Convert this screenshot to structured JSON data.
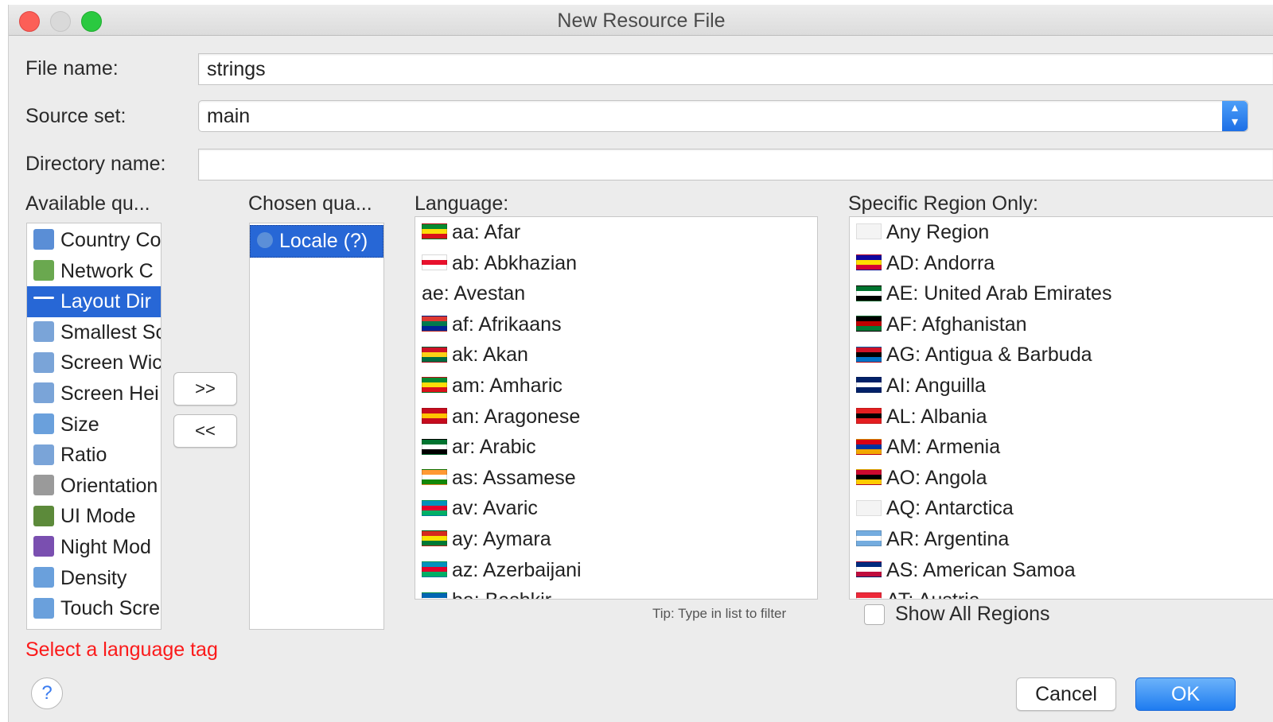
{
  "window": {
    "title": "New Resource File"
  },
  "form": {
    "file_name_label": "File name:",
    "file_name_value": "strings",
    "source_set_label": "Source set:",
    "source_set_value": "main",
    "directory_name_label": "Directory name:",
    "directory_name_value": ""
  },
  "available": {
    "header": "Available qu...",
    "items": [
      {
        "label": "Country Co",
        "icon": "globe-phone-icon",
        "color": "#5a8ed6"
      },
      {
        "label": "Network C",
        "icon": "network-icon",
        "color": "#6aa84f"
      },
      {
        "label": "Layout Dir",
        "icon": "layout-direction-icon",
        "color": "#ffffff"
      },
      {
        "label": "Smallest Sc",
        "icon": "smallest-screen-icon",
        "color": "#7aa4d8"
      },
      {
        "label": "Screen Wic",
        "icon": "screen-width-icon",
        "color": "#7aa4d8"
      },
      {
        "label": "Screen Hei",
        "icon": "screen-height-icon",
        "color": "#7aa4d8"
      },
      {
        "label": "Size",
        "icon": "size-icon",
        "color": "#6aa0dc"
      },
      {
        "label": "Ratio",
        "icon": "ratio-icon",
        "color": "#7aa4d8"
      },
      {
        "label": "Orientation",
        "icon": "orientation-icon",
        "color": "#9a9a9a"
      },
      {
        "label": "UI Mode",
        "icon": "ui-mode-icon",
        "color": "#5c8a3a"
      },
      {
        "label": "Night Mod",
        "icon": "night-mode-icon",
        "color": "#7a4fb0"
      },
      {
        "label": "Density",
        "icon": "density-icon",
        "color": "#6aa0dc"
      },
      {
        "label": "Touch Scre",
        "icon": "touch-screen-icon",
        "color": "#6aa0dc"
      }
    ],
    "selected_index": 2
  },
  "transfer": {
    "add_label": ">>",
    "remove_label": "<<"
  },
  "chosen": {
    "header": "Chosen qua...",
    "items": [
      {
        "label": "Locale (?)",
        "icon": "globe-icon"
      }
    ]
  },
  "language": {
    "header": "Language:",
    "items": [
      {
        "label": "aa: Afar",
        "flag": [
          "#078930",
          "#fcdd09",
          "#da121a"
        ]
      },
      {
        "label": "ab: Abkhazian",
        "flag": [
          "#ffffff",
          "#e8112d",
          "#ffffff"
        ]
      },
      {
        "label": "ae: Avestan",
        "flag": []
      },
      {
        "label": "af: Afrikaans",
        "flag": [
          "#de3831",
          "#007a4d",
          "#002395"
        ]
      },
      {
        "label": "ak: Akan",
        "flag": [
          "#ce1126",
          "#fcd116",
          "#006b3f"
        ]
      },
      {
        "label": "am: Amharic",
        "flag": [
          "#078930",
          "#fcdd09",
          "#da121a"
        ]
      },
      {
        "label": "an: Aragonese",
        "flag": [
          "#c60b1e",
          "#ffc400",
          "#c60b1e"
        ]
      },
      {
        "label": "ar: Arabic",
        "flag": [
          "#00732f",
          "#ffffff",
          "#000000"
        ]
      },
      {
        "label": "as: Assamese",
        "flag": [
          "#ff9933",
          "#ffffff",
          "#138808"
        ]
      },
      {
        "label": "av: Avaric",
        "flag": [
          "#0092bc",
          "#e4002b",
          "#00af66"
        ]
      },
      {
        "label": "ay: Aymara",
        "flag": [
          "#d52b1e",
          "#f9e300",
          "#007934"
        ]
      },
      {
        "label": "az: Azerbaijani",
        "flag": [
          "#0092bc",
          "#e4002b",
          "#00af66"
        ]
      },
      {
        "label": "ba: Bashkir",
        "flag": [
          "#0066b3",
          "#ffffff",
          "#00a650"
        ]
      }
    ],
    "tip": "Tip: Type in list to filter"
  },
  "region": {
    "header": "Specific Region Only:",
    "items": [
      {
        "label": "Any Region",
        "flag": []
      },
      {
        "label": "AD: Andorra",
        "flag": [
          "#10069f",
          "#fedd00",
          "#d50032"
        ]
      },
      {
        "label": "AE: United Arab Emirates",
        "flag": [
          "#00732f",
          "#ffffff",
          "#000000"
        ]
      },
      {
        "label": "AF: Afghanistan",
        "flag": [
          "#000000",
          "#be0000",
          "#007a36"
        ]
      },
      {
        "label": "AG: Antigua & Barbuda",
        "flag": [
          "#ce1126",
          "#000000",
          "#0072c6"
        ]
      },
      {
        "label": "AI: Anguilla",
        "flag": [
          "#012169",
          "#ffffff",
          "#012169"
        ]
      },
      {
        "label": "AL: Albania",
        "flag": [
          "#e41e20",
          "#000000",
          "#e41e20"
        ]
      },
      {
        "label": "AM: Armenia",
        "flag": [
          "#d90012",
          "#0033a0",
          "#f2a800"
        ]
      },
      {
        "label": "AO: Angola",
        "flag": [
          "#cc092f",
          "#000000",
          "#ffcb00"
        ]
      },
      {
        "label": "AQ: Antarctica",
        "flag": []
      },
      {
        "label": "AR: Argentina",
        "flag": [
          "#74acdf",
          "#ffffff",
          "#74acdf"
        ]
      },
      {
        "label": "AS: American Samoa",
        "flag": [
          "#002b7f",
          "#ffffff",
          "#bf0d3e"
        ]
      },
      {
        "label": "AT: Austria",
        "flag": [
          "#ed2939",
          "#ffffff",
          "#ed2939"
        ]
      }
    ],
    "show_all_label": "Show All Regions"
  },
  "error_message": "Select a language tag",
  "buttons": {
    "help": "?",
    "cancel": "Cancel",
    "ok": "OK"
  }
}
